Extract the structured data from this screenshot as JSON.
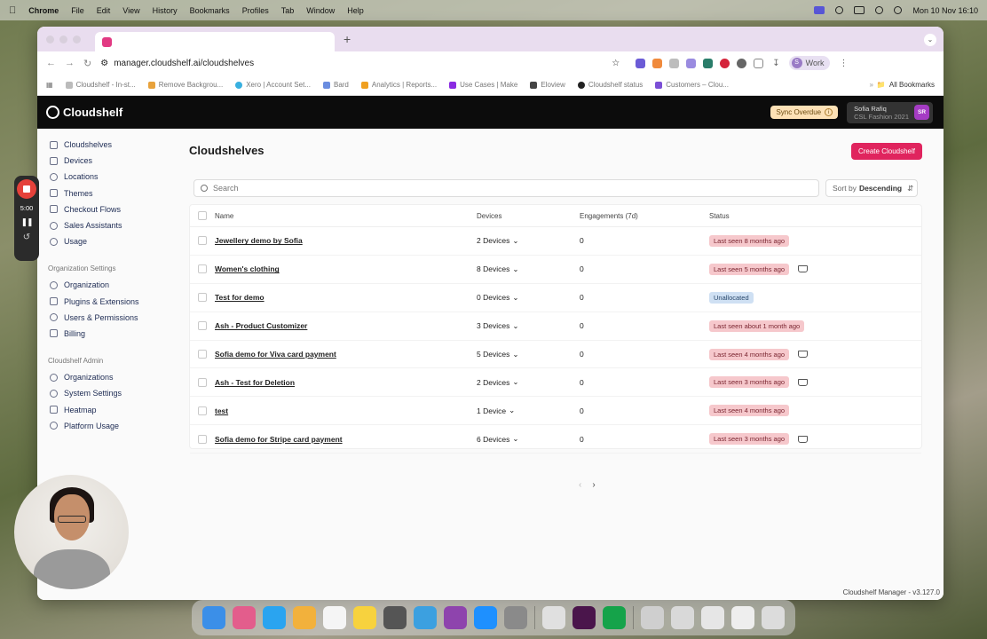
{
  "menubar": {
    "items": [
      "Chrome",
      "File",
      "Edit",
      "View",
      "History",
      "Bookmarks",
      "Profiles",
      "Tab",
      "Window",
      "Help"
    ],
    "clock": "Mon 10 Nov  16:10"
  },
  "browser": {
    "url": "manager.cloudshelf.ai/cloudshelves",
    "profile_label": "Work",
    "profile_initial": "S",
    "bookmarks": [
      "Cloudshelf - In-st...",
      "Remove Backgrou...",
      "Xero | Account Set...",
      "Bard",
      "Analytics | Reports...",
      "Use Cases | Make",
      "Eloview",
      "Cloudshelf status",
      "Customers – Clou..."
    ],
    "all_bookmarks": "All Bookmarks"
  },
  "header": {
    "logo": "Cloudshelf",
    "sync_label": "Sync Overdue",
    "user_name": "Sofia Rafiq",
    "user_org": "CSL Fashion 2021",
    "user_initials": "SR"
  },
  "sidebar": {
    "items": [
      {
        "label": "Cloudshelves",
        "icon": "shelf-icon"
      },
      {
        "label": "Devices",
        "icon": "device-icon"
      },
      {
        "label": "Locations",
        "icon": "location-icon"
      },
      {
        "label": "Themes",
        "icon": "theme-icon"
      },
      {
        "label": "Checkout Flows",
        "icon": "checkout-icon"
      },
      {
        "label": "Sales Assistants",
        "icon": "assistant-icon"
      },
      {
        "label": "Usage",
        "icon": "usage-icon"
      }
    ],
    "org_title": "Organization Settings",
    "org_items": [
      {
        "label": "Organization",
        "icon": "organization-icon"
      },
      {
        "label": "Plugins & Extensions",
        "icon": "plugin-icon"
      },
      {
        "label": "Users & Permissions",
        "icon": "users-icon"
      },
      {
        "label": "Billing",
        "icon": "billing-icon"
      }
    ],
    "admin_title": "Cloudshelf Admin",
    "admin_items": [
      {
        "label": "Organizations",
        "icon": "organizations-icon"
      },
      {
        "label": "System Settings",
        "icon": "settings-icon"
      },
      {
        "label": "Heatmap",
        "icon": "heatmap-icon"
      },
      {
        "label": "Platform Usage",
        "icon": "platform-usage-icon"
      }
    ]
  },
  "main": {
    "title": "Cloudshelves",
    "create_button": "Create Cloudshelf",
    "search_placeholder": "Search",
    "sort_prefix": "Sort by",
    "sort_value": "Descending",
    "columns": [
      "Name",
      "Devices",
      "Engagements (7d)",
      "Status"
    ],
    "rows": [
      {
        "name": "Jewellery demo by Sofia",
        "devices": "2 Devices",
        "engagements": "0",
        "status": "Last seen 8 months ago",
        "status_type": "red",
        "cart": false
      },
      {
        "name": "Women's clothing",
        "devices": "8 Devices",
        "engagements": "0",
        "status": "Last seen 5 months ago",
        "status_type": "red",
        "cart": true
      },
      {
        "name": "Test for demo",
        "devices": "0 Devices",
        "engagements": "0",
        "status": "Unallocated",
        "status_type": "blue",
        "cart": false
      },
      {
        "name": "Ash - Product Customizer",
        "devices": "3 Devices",
        "engagements": "0",
        "status": "Last seen about 1 month ago",
        "status_type": "red",
        "cart": false
      },
      {
        "name": "Sofia demo for Viva card payment",
        "devices": "5 Devices",
        "engagements": "0",
        "status": "Last seen 4 months ago",
        "status_type": "red",
        "cart": true
      },
      {
        "name": "Ash - Test for Deletion",
        "devices": "2 Devices",
        "engagements": "0",
        "status": "Last seen 3 months ago",
        "status_type": "red",
        "cart": true
      },
      {
        "name": "test",
        "devices": "1 Device",
        "engagements": "0",
        "status": "Last seen 4 months ago",
        "status_type": "red",
        "cart": false
      },
      {
        "name": "Sofia demo for Stripe card payment",
        "devices": "6 Devices",
        "engagements": "0",
        "status": "Last seen 3 months ago",
        "status_type": "red",
        "cart": true
      }
    ],
    "version": "Cloudshelf Manager - v3.127.0"
  },
  "recorder": {
    "time": "5:00"
  },
  "colors": {
    "accent": "#e0245e",
    "header_bg": "#0c0c0c",
    "status_red_bg": "#f6c8cc",
    "status_blue_bg": "#cfe0f3"
  }
}
